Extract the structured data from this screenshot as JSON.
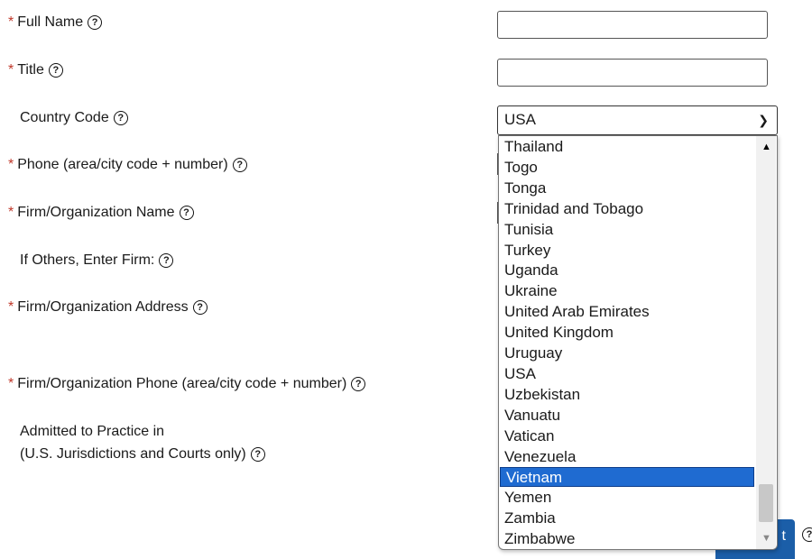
{
  "form": {
    "help_glyph": "?",
    "required_mark": "*",
    "fields": [
      {
        "label": "Full Name",
        "required": true
      },
      {
        "label": "Title",
        "required": true
      },
      {
        "label": "Country Code",
        "required": false
      },
      {
        "label": "Phone (area/city code + number)",
        "required": true
      },
      {
        "label": "Firm/Organization Name",
        "required": true
      },
      {
        "label": "If Others, Enter Firm:",
        "required": false
      },
      {
        "label": "Firm/Organization Address",
        "required": true
      },
      {
        "label": "Firm/Organization Phone (area/city code + number)",
        "required": true
      },
      {
        "label_line1": "Admitted to Practice in",
        "label_line2": "(U.S. Jurisdictions and Courts only)",
        "required": false
      }
    ]
  },
  "country_select": {
    "value": "USA",
    "options_visible": [
      "Thailand",
      "Togo",
      "Tonga",
      "Trinidad and Tobago",
      "Tunisia",
      "Turkey",
      "Uganda",
      "Ukraine",
      "United Arab Emirates",
      "United Kingdom",
      "Uruguay",
      "USA",
      "Uzbekistan",
      "Vanuatu",
      "Vatican",
      "Venezuela",
      "Vietnam",
      "Yemen",
      "Zambia",
      "Zimbabwe"
    ],
    "highlighted_option": "Vietnam"
  },
  "button_partial_label": "t",
  "colors": {
    "highlight": "#1f6bd1",
    "button": "#1b5ea8",
    "required": "#c0392b"
  }
}
